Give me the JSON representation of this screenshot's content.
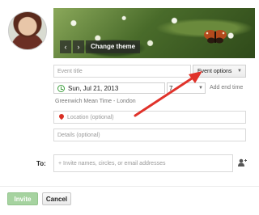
{
  "banner": {
    "prev_label": "‹",
    "next_label": "›",
    "change_theme_label": "Change theme"
  },
  "event": {
    "title_placeholder": "Event title",
    "options_label": "Event options",
    "date_value": "Sun, Jul 21, 2013",
    "time_value": "7",
    "add_end_time_label": "Add end time",
    "timezone": "Greenwich Mean Time - London",
    "location_placeholder": "Location (optional)",
    "details_placeholder": "Details (optional)"
  },
  "invite": {
    "to_label": "To:",
    "input_placeholder": "+ Invite names, circles, or email addresses"
  },
  "actions": {
    "invite_label": "Invite",
    "cancel_label": "Cancel"
  },
  "colors": {
    "annotation_arrow": "#e0322a",
    "invite_button": "#a6d3a0",
    "clock_green": "#3fa03f",
    "pin_red": "#d93025"
  }
}
